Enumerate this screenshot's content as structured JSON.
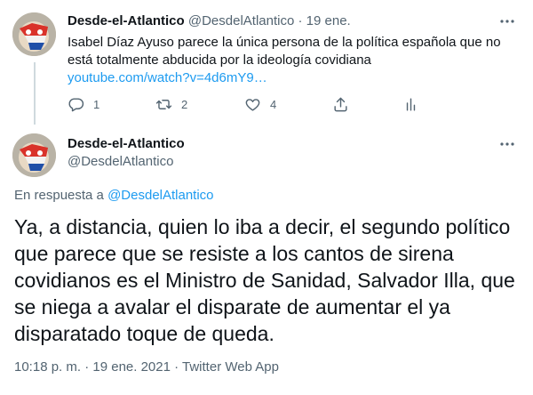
{
  "parent_tweet": {
    "display_name": "Desde-el-Atlantico",
    "handle": "@DesdelAtlantico",
    "separator": "·",
    "date": "19 ene.",
    "text": "Isabel Díaz Ayuso parece la única persona de la política española que no está totalmente abducida por la ideología covidiana",
    "link": "youtube.com/watch?v=4d6mY9…",
    "actions": {
      "reply_count": "1",
      "retweet_count": "2",
      "like_count": "4"
    }
  },
  "main_tweet": {
    "display_name": "Desde-el-Atlantico",
    "handle": "@DesdelAtlantico",
    "reply_prefix": "En respuesta a",
    "reply_to": "@DesdelAtlantico",
    "text": "Ya, a distancia, quien lo iba a decir, el segundo político que parece que se resiste a los cantos de sirena covidianos es el Ministro de Sanidad, Salvador Illa, que se niega a avalar el disparate de aumentar el ya disparatado toque de queda.",
    "timestamp": "10:18 p. m. · 19 ene. 2021 · Twitter Web App"
  },
  "icons": {
    "more": "more-horizontal-icon",
    "reply": "reply-bubble-icon",
    "retweet": "retweet-icon",
    "like": "heart-icon",
    "share": "share-icon",
    "analytics": "analytics-bars-icon"
  },
  "colors": {
    "link": "#1d9bf0",
    "secondary_text": "#536471",
    "primary_text": "#0f1419",
    "thread_line": "#cfd9de"
  }
}
